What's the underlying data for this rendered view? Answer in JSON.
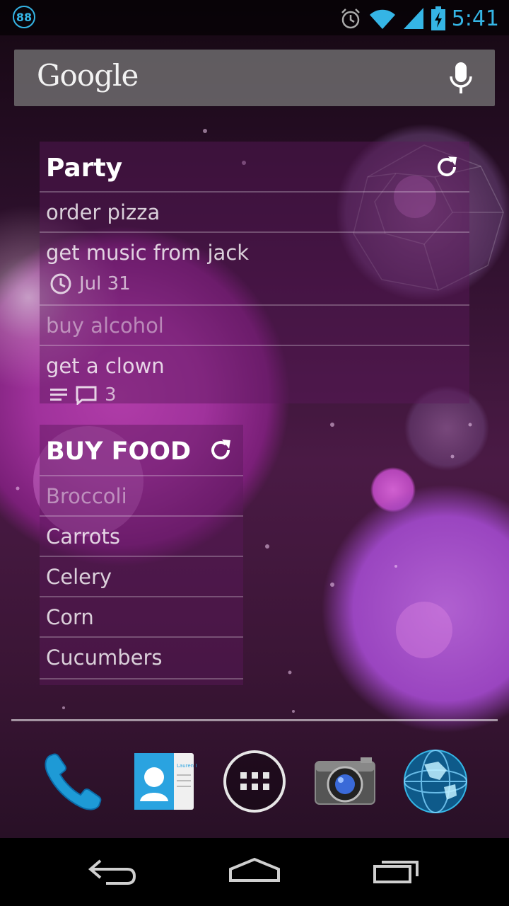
{
  "status_bar": {
    "notification_badge": "88",
    "time": "5:41",
    "icons": [
      "alarm-icon",
      "wifi-icon",
      "cell-signal-icon",
      "battery-charging-icon"
    ],
    "accent_color": "#35b5e5"
  },
  "search": {
    "logo_text": "Google",
    "icon": "mic-icon"
  },
  "widget_party": {
    "title": "Party",
    "items": [
      {
        "text": "order pizza"
      },
      {
        "text": "get music from jack",
        "due": "Jul 31"
      },
      {
        "text": "buy alcohol"
      },
      {
        "text": "get a clown",
        "comments": "3"
      }
    ]
  },
  "widget_food": {
    "title": "BUY FOOD",
    "items": [
      "Broccoli",
      "Carrots",
      "Celery",
      "Corn",
      "Cucumbers"
    ]
  },
  "dock": {
    "apps": [
      "phone-icon",
      "contacts-icon",
      "app-drawer-icon",
      "camera-icon",
      "browser-globe-icon"
    ],
    "contacts_card_text": "Lauren Ipsum"
  },
  "nav_bar": {
    "buttons": [
      "back-icon",
      "home-icon",
      "recents-icon"
    ]
  }
}
